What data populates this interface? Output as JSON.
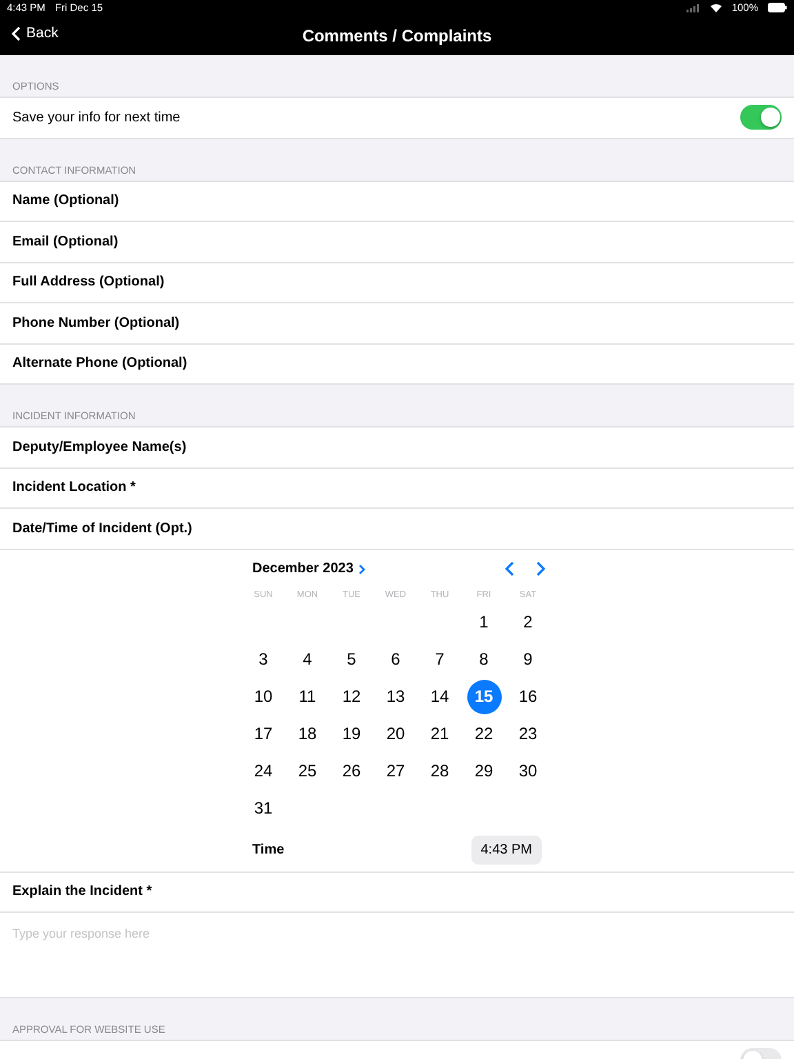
{
  "status_bar": {
    "time": "4:43 PM",
    "date": "Fri Dec 15",
    "battery": "100%"
  },
  "nav": {
    "back": "Back",
    "title": "Comments / Complaints"
  },
  "sections": [
    {
      "header": "OPTIONS",
      "rows": [
        {
          "kind": "toggle",
          "label": "Save your info for next time",
          "on": true
        }
      ]
    },
    {
      "header": "CONTACT INFORMATION",
      "rows": [
        {
          "kind": "field",
          "label": "Name (Optional)"
        },
        {
          "kind": "field",
          "label": "Email (Optional)"
        },
        {
          "kind": "field",
          "label": "Full Address (Optional)"
        },
        {
          "kind": "field",
          "label": "Phone Number (Optional)"
        },
        {
          "kind": "field",
          "label": "Alternate Phone (Optional)"
        }
      ]
    },
    {
      "header": "INCIDENT INFORMATION",
      "rows": [
        {
          "kind": "field",
          "label": "Deputy/Employee Name(s)"
        },
        {
          "kind": "field",
          "label": "Incident Location *"
        },
        {
          "kind": "field",
          "label": "Date/Time of Incident (Opt.)"
        },
        {
          "kind": "calendar",
          "month": "December 2023",
          "weekdays": [
            "SUN",
            "MON",
            "TUE",
            "WED",
            "THU",
            "FRI",
            "SAT"
          ],
          "weeks": [
            {
              "kind": "start",
              "days": [
                {
                  "label": "1",
                  "selected": false
                },
                {
                  "label": "2",
                  "selected": false
                }
              ]
            },
            {
              "kind": "full",
              "days": [
                {
                  "label": "3",
                  "selected": false
                },
                {
                  "label": "4",
                  "selected": false
                },
                {
                  "label": "5",
                  "selected": false
                },
                {
                  "label": "6",
                  "selected": false
                },
                {
                  "label": "7",
                  "selected": false
                },
                {
                  "label": "8",
                  "selected": false
                },
                {
                  "label": "9",
                  "selected": false
                }
              ]
            },
            {
              "kind": "full",
              "days": [
                {
                  "label": "10",
                  "selected": false
                },
                {
                  "label": "11",
                  "selected": false
                },
                {
                  "label": "12",
                  "selected": false
                },
                {
                  "label": "13",
                  "selected": false
                },
                {
                  "label": "14",
                  "selected": false
                },
                {
                  "label": "15",
                  "selected": true
                },
                {
                  "label": "16",
                  "selected": false
                }
              ]
            },
            {
              "kind": "full",
              "days": [
                {
                  "label": "17",
                  "selected": false
                },
                {
                  "label": "18",
                  "selected": false
                },
                {
                  "label": "19",
                  "selected": false
                },
                {
                  "label": "20",
                  "selected": false
                },
                {
                  "label": "21",
                  "selected": false
                },
                {
                  "label": "22",
                  "selected": false
                },
                {
                  "label": "23",
                  "selected": false
                }
              ]
            },
            {
              "kind": "full",
              "days": [
                {
                  "label": "24",
                  "selected": false
                },
                {
                  "label": "25",
                  "selected": false
                },
                {
                  "label": "26",
                  "selected": false
                },
                {
                  "label": "27",
                  "selected": false
                },
                {
                  "label": "28",
                  "selected": false
                },
                {
                  "label": "29",
                  "selected": false
                },
                {
                  "label": "30",
                  "selected": false
                }
              ]
            },
            {
              "kind": "end",
              "days": [
                {
                  "label": "31",
                  "selected": false
                }
              ]
            }
          ],
          "time_label": "Time",
          "time": "4:43 PM"
        },
        {
          "kind": "field",
          "label": "Explain the Incident *"
        },
        {
          "kind": "textarea",
          "placeholder": "Type your response here"
        }
      ]
    },
    {
      "header": "APPROVAL FOR WEBSITE USE",
      "rows": [
        {
          "kind": "toggle",
          "on": false
        }
      ]
    }
  ]
}
